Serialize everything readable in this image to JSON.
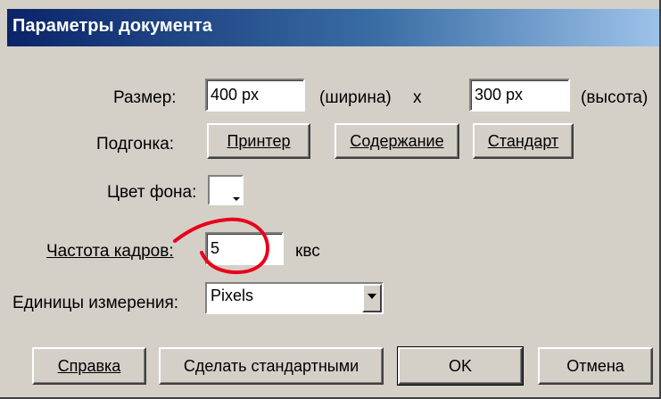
{
  "window": {
    "title": "Параметры документа"
  },
  "size": {
    "label": "Размер:",
    "width_value": "400 px",
    "width_label": "(ширина)",
    "times": "x",
    "height_value": "300 px",
    "height_label": "(высота)"
  },
  "fit": {
    "label": "Подгонка:",
    "printer_button": "Принтер",
    "contents_button": "Содержание",
    "default_button": "Стандарт"
  },
  "background": {
    "label": "Цвет фона:",
    "color": "#ffffff"
  },
  "frame_rate": {
    "label": "Частота кадров:",
    "value": "5",
    "unit": "квс"
  },
  "units": {
    "label": "Единицы измерения:",
    "selected": "Pixels"
  },
  "buttons": {
    "help": "Справка",
    "make_default": "Сделать стандартными",
    "ok": "OK",
    "cancel": "Отмена"
  },
  "annotation": {
    "color": "#e8001c"
  }
}
